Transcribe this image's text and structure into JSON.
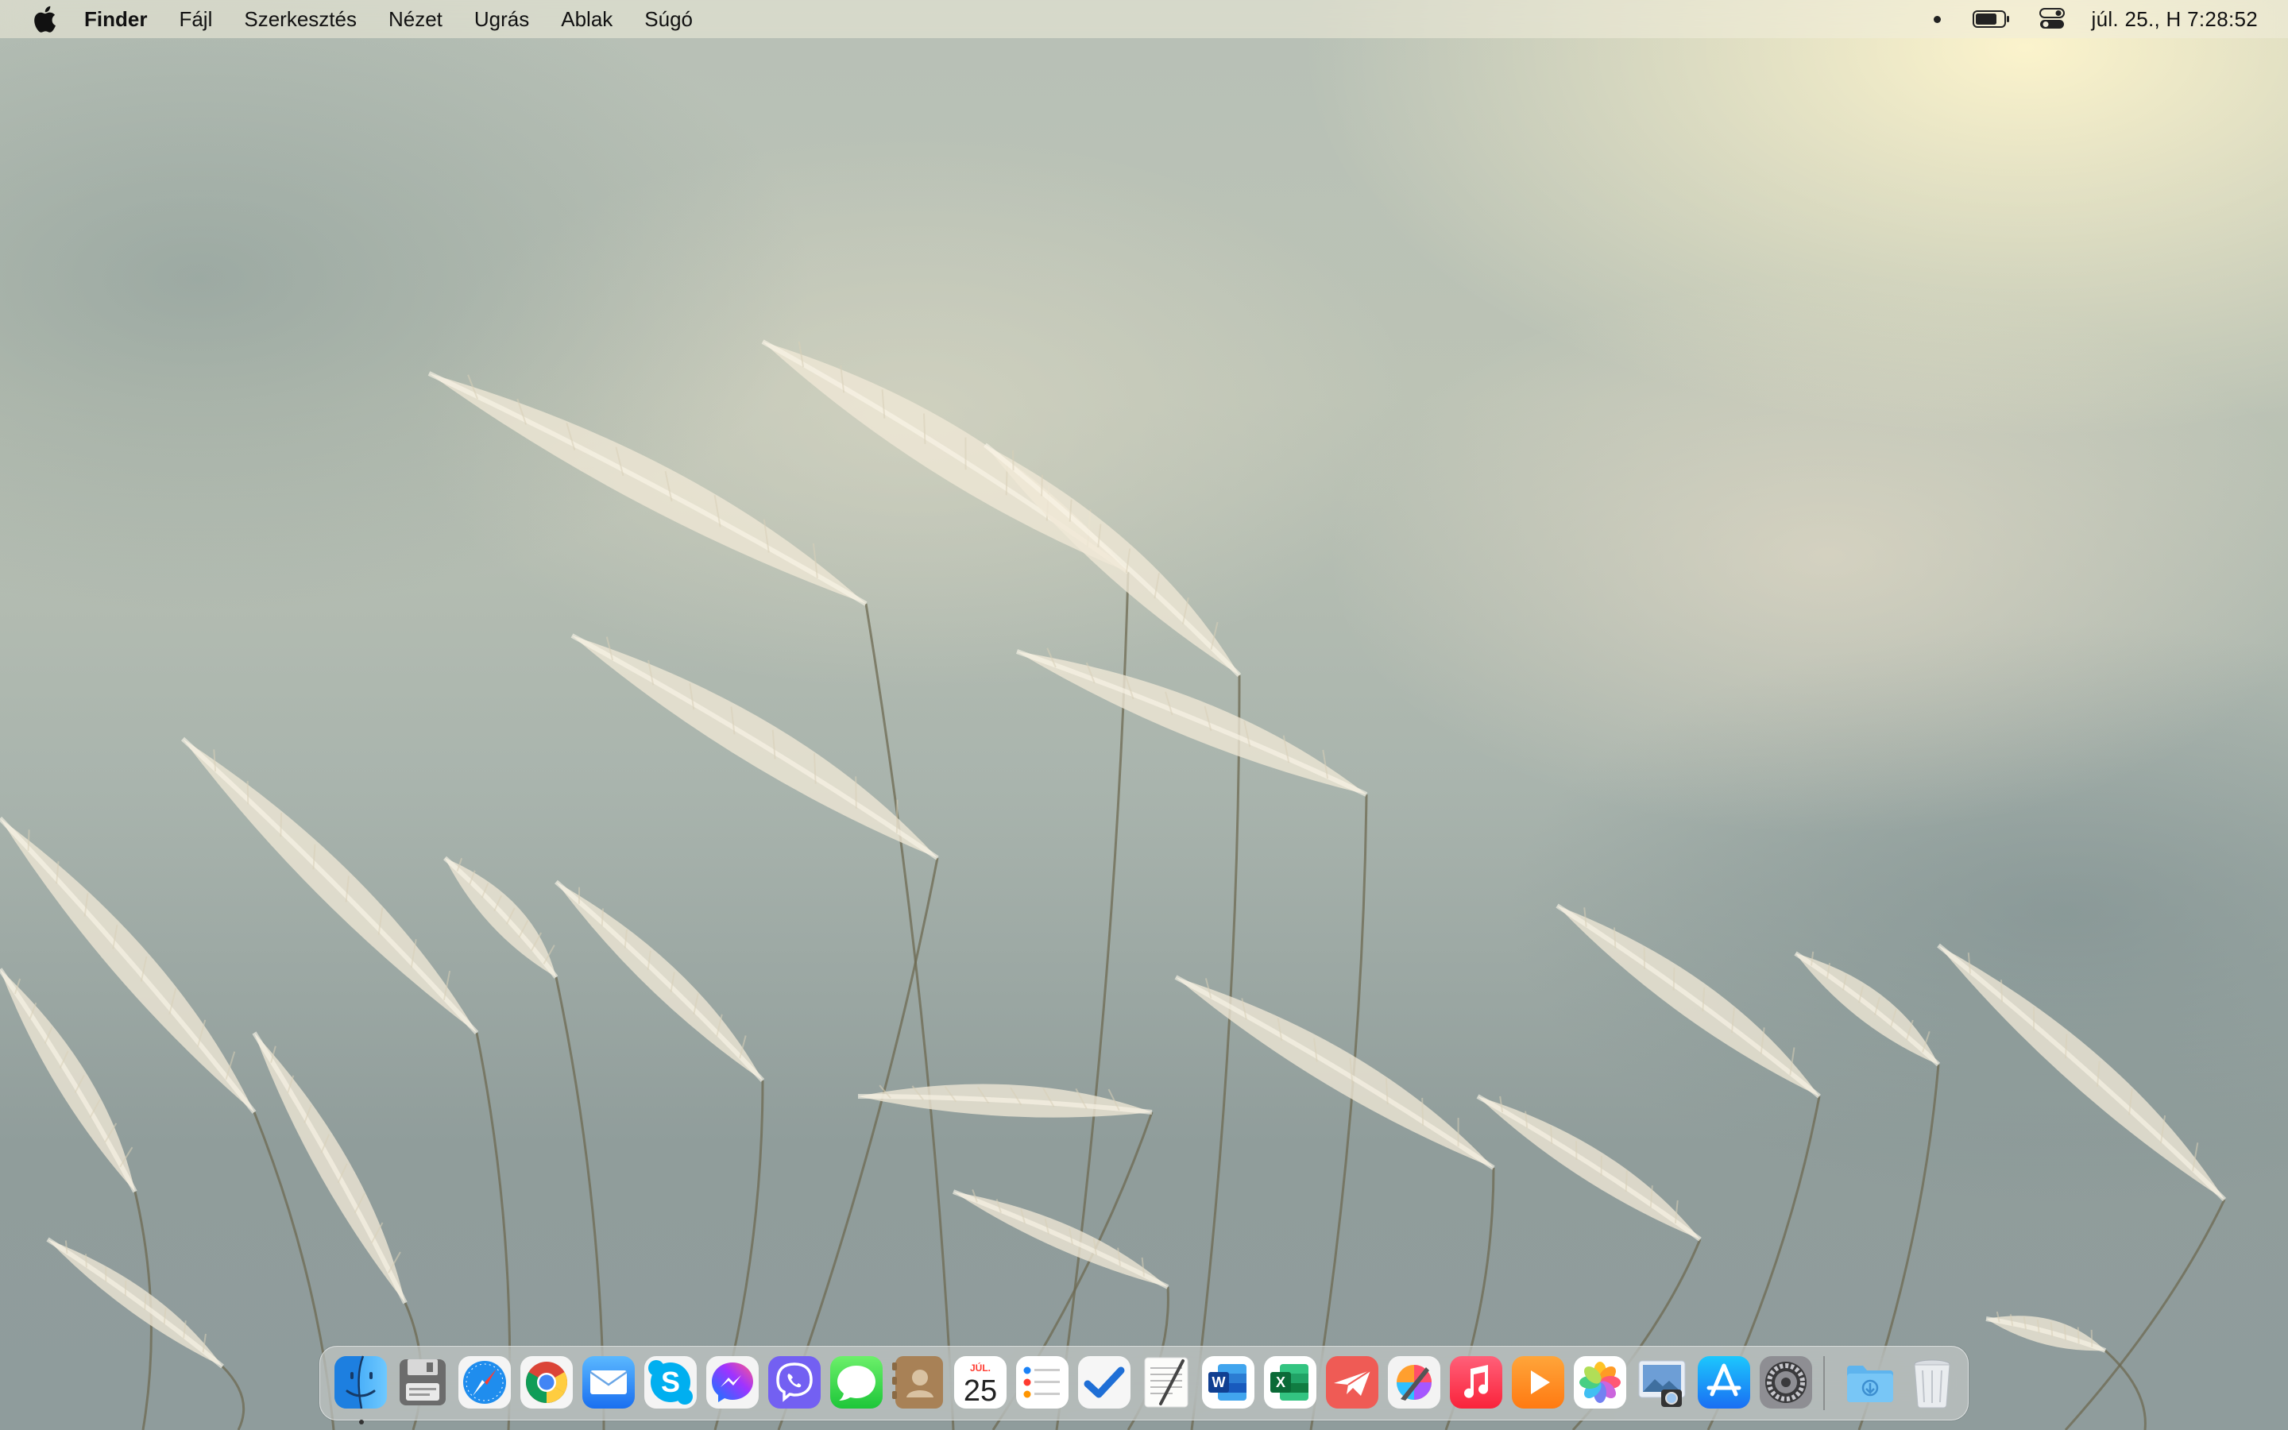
{
  "menubar": {
    "apple_icon": "apple-logo-icon",
    "app_name": "Finder",
    "menus": [
      "Fájl",
      "Szerkesztés",
      "Nézet",
      "Ugrás",
      "Ablak",
      "Súgó"
    ],
    "status": {
      "battery_icon": "battery-icon",
      "control_center_icon": "control-center-icon",
      "clock": "júl. 25., H  7:28:52"
    }
  },
  "calendar": {
    "month": "JÚL.",
    "day": "25"
  },
  "dock": {
    "apps": [
      "finder",
      "disk-utility",
      "safari",
      "chrome",
      "mail",
      "skype",
      "messenger",
      "viber",
      "messages",
      "contacts",
      "calendar",
      "reminders",
      "tasks",
      "textedit",
      "word",
      "excel",
      "airmail",
      "pixelmator",
      "music",
      "infuse",
      "photos",
      "preview",
      "app-store",
      "system-preferences"
    ],
    "running": [
      "finder"
    ],
    "right": [
      "downloads-stack",
      "trash"
    ]
  },
  "colors": {
    "accent": "#1a82f7",
    "menubar_text": "#111111"
  }
}
